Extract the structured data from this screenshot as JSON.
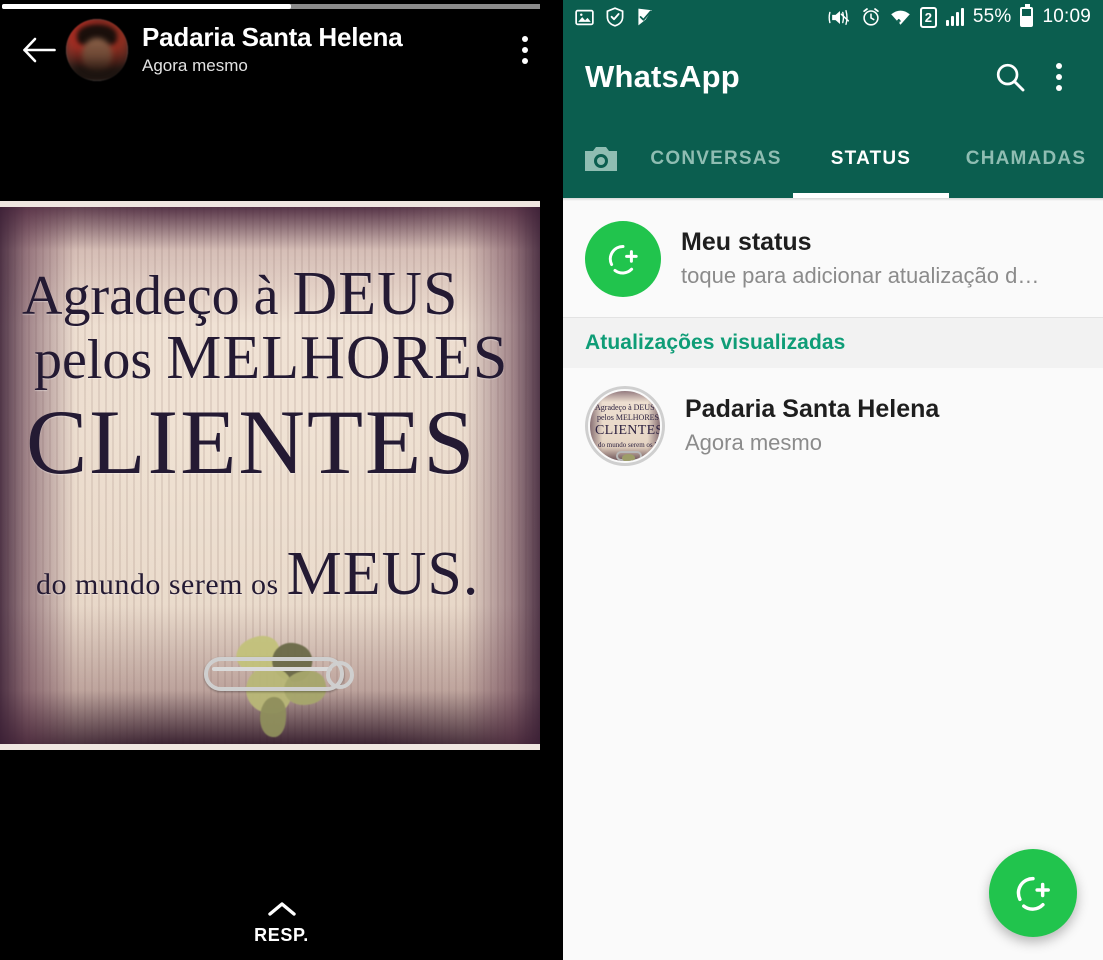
{
  "viewer": {
    "progress_percent": 52,
    "back_icon": "back-arrow-icon",
    "contact_name": "Padaria Santa Helena",
    "timestamp": "Agora mesmo",
    "overflow_icon": "more-vertical-icon",
    "reply_label": "RESP.",
    "reply_icon": "chevron-up-icon",
    "media": {
      "line1_a": "A",
      "line1_b": "gradeço à ",
      "line1_c": "DEUS",
      "line2_a": "pelos ",
      "line2_b": "MELHORES",
      "line3": "CLIENTES",
      "line4_a": "do mundo serem os ",
      "line4_b": "MEUS.",
      "object_icon": "safety-pin-with-rue-sprig"
    }
  },
  "whatsapp": {
    "statusbar": {
      "left_icons": [
        "photo-icon",
        "security-shield-icon",
        "app-check-icon"
      ],
      "right_icons": [
        "vibrate-mute-icon",
        "alarm-clock-icon",
        "wifi-icon",
        "sim-2-icon",
        "signal-bars-icon",
        "battery-icon"
      ],
      "sim_label": "2",
      "battery_percent": "55%",
      "clock": "10:09"
    },
    "toolbar": {
      "title": "WhatsApp",
      "search_icon": "search-icon",
      "overflow_icon": "more-vertical-icon"
    },
    "tabs": {
      "camera_icon": "camera-icon",
      "items": [
        {
          "label": "CONVERSAS",
          "active": false
        },
        {
          "label": "STATUS",
          "active": true
        },
        {
          "label": "CHAMADAS",
          "active": false
        }
      ]
    },
    "my_status": {
      "icon": "add-status-icon",
      "title": "Meu status",
      "subtitle": "toque para adicionar atualização d…"
    },
    "section_viewed": {
      "header": "Atualizações visualizadas",
      "rows": [
        {
          "name": "Padaria Santa Helena",
          "time": "Agora mesmo",
          "thumb_icon": "status-thumbnail",
          "thumb_line1": "Agradeço à DEUS",
          "thumb_line2": "pelos MELHORES",
          "thumb_line3": "CLIENTES",
          "thumb_line4": "do mundo serem os MEUS."
        }
      ]
    },
    "fab": {
      "icon": "add-status-fab-icon"
    }
  },
  "colors": {
    "toolbar_green": "#0b5e4f",
    "accent_green": "#21c44d",
    "section_header_green": "#0f9d77",
    "tab_inactive": "#8fbdb2",
    "body_bg": "#fafafa"
  }
}
